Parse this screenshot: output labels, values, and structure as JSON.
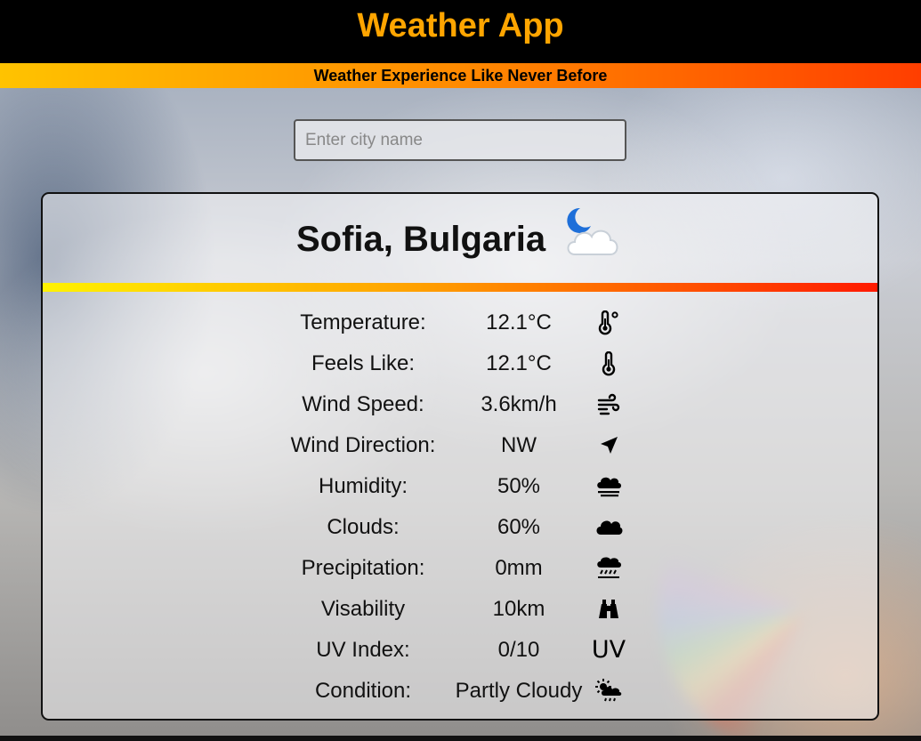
{
  "app": {
    "title": "Weather App",
    "tagline": "Weather Experience Like Never Before",
    "accent_color": "#FFA500"
  },
  "search": {
    "placeholder": "Enter city name",
    "value": ""
  },
  "card": {
    "location": "Sofia, Bulgaria",
    "condition_icon": "partly-cloudy-night-icon",
    "rows": [
      {
        "label": "Temperature:",
        "value": "12.1°C",
        "icon": "thermometer-degree-icon"
      },
      {
        "label": "Feels Like:",
        "value": "12.1°C",
        "icon": "thermometer-icon"
      },
      {
        "label": "Wind Speed:",
        "value": "3.6km/h",
        "icon": "wind-icon"
      },
      {
        "label": "Wind Direction:",
        "value": "NW",
        "icon": "navigation-arrow-icon"
      },
      {
        "label": "Humidity:",
        "value": "50%",
        "icon": "fog-cloud-icon"
      },
      {
        "label": "Clouds:",
        "value": "60%",
        "icon": "cloud-icon"
      },
      {
        "label": "Precipitation:",
        "value": "0mm",
        "icon": "cloud-rain-icon"
      },
      {
        "label": "Visability",
        "value": "10km",
        "icon": "binoculars-icon"
      },
      {
        "label": "UV Index:",
        "value": "0/10",
        "icon": "uv-icon",
        "icon_text": "UV"
      },
      {
        "label": "Condition:",
        "value": "Partly Cloudy",
        "icon": "sun-cloud-rain-icon"
      }
    ]
  }
}
